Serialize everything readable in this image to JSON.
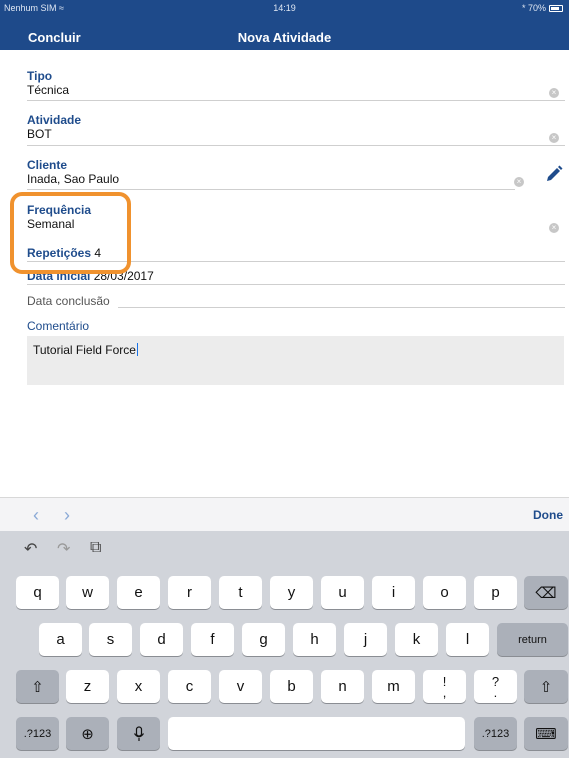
{
  "status": {
    "carrier": "Nenhum SIM ≈",
    "time": "14:19",
    "battery": "* 70%"
  },
  "nav": {
    "left": "Concluir",
    "title": "Nova Atividade"
  },
  "form": {
    "tipo": {
      "label": "Tipo",
      "value": "Técnica"
    },
    "atividade": {
      "label": "Atividade",
      "value": "BOT"
    },
    "cliente": {
      "label": "Cliente",
      "value": "Inada, Sao Paulo"
    },
    "frequencia": {
      "label": "Frequência",
      "value": "Semanal"
    },
    "repeticoes": {
      "label": "Repetições",
      "value": "4"
    },
    "data_inicial": {
      "label": "Data inicial",
      "value": "28/03/2017"
    },
    "data_conclusao": {
      "label": "Data conclusão"
    },
    "comentario": {
      "label": "Comentário",
      "value": "Tutorial Field Force"
    }
  },
  "accessory": {
    "prev": "‹",
    "next": "›",
    "done": "Done"
  },
  "keyboard": {
    "toolbar": [
      "↶",
      "↷",
      "⧉"
    ],
    "row1": [
      "q",
      "w",
      "e",
      "r",
      "t",
      "y",
      "u",
      "i",
      "o",
      "p"
    ],
    "backspace": "⌫",
    "row2": [
      "a",
      "s",
      "d",
      "f",
      "g",
      "h",
      "j",
      "k",
      "l"
    ],
    "return": "return",
    "shift": "⇧",
    "row3": [
      "z",
      "x",
      "c",
      "v",
      "b",
      "n",
      "m"
    ],
    "punct1": [
      "!",
      ","
    ],
    "punct2": [
      "?",
      "."
    ],
    "numbers": ".?123",
    "globe": "⊕",
    "mic": "🎙",
    "kb_hide": "⌨"
  },
  "colors": {
    "header": "#1e4a8a",
    "label": "#1f4c8c",
    "highlight": "#f0922e",
    "keyboard": "#d1d4da"
  }
}
